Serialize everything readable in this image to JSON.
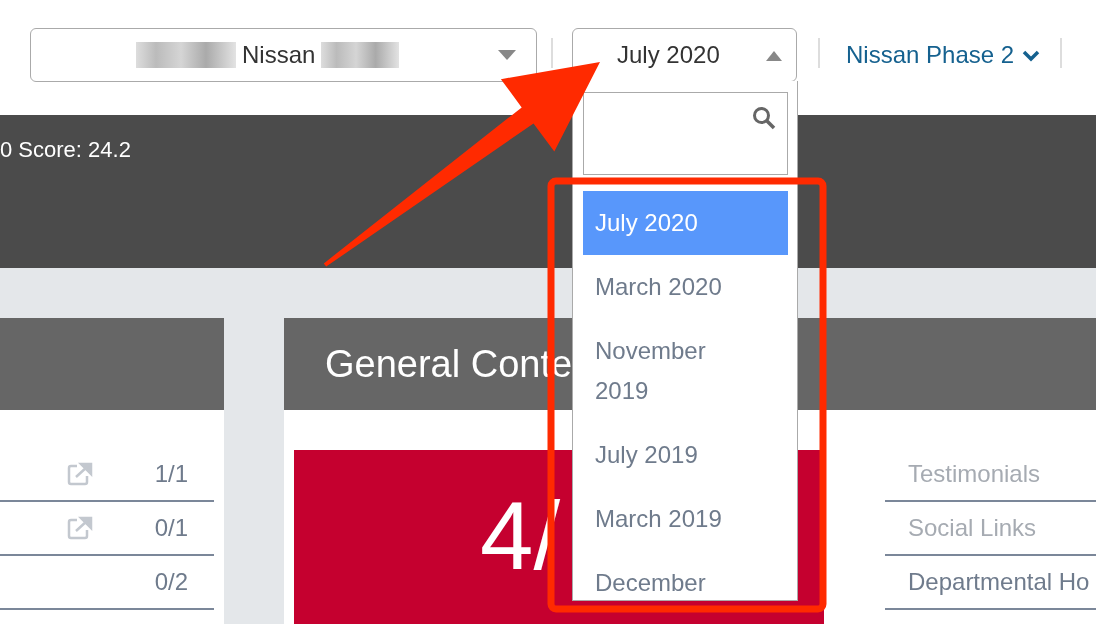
{
  "top_bar": {
    "dealer_select": {
      "value": "Nissan"
    },
    "month_select": {
      "value": "July 2020",
      "expanded": true
    },
    "phase_link": {
      "label": "Nissan Phase 2"
    }
  },
  "banner": {
    "score_line": "0 Score: 24.2"
  },
  "left_card": {
    "rows": [
      {
        "value": "1/1",
        "external_link": true
      },
      {
        "value": "0/1",
        "external_link": true
      },
      {
        "value": "0/2",
        "external_link": false
      }
    ]
  },
  "main_card": {
    "title": "General Conte",
    "score": "4/",
    "items": [
      {
        "label": "Testimonials",
        "muted": true
      },
      {
        "label": "Social Links",
        "muted": true
      },
      {
        "label": "Departmental Ho",
        "muted": false
      }
    ]
  },
  "month_dropdown": {
    "options": [
      {
        "label": "July 2020",
        "selected": true
      },
      {
        "label": "March 2020",
        "selected": false
      },
      {
        "label": "November 2019",
        "selected": false
      },
      {
        "label": "July 2019",
        "selected": false
      },
      {
        "label": "March 2019",
        "selected": false
      },
      {
        "label": "December",
        "selected": false
      }
    ]
  }
}
